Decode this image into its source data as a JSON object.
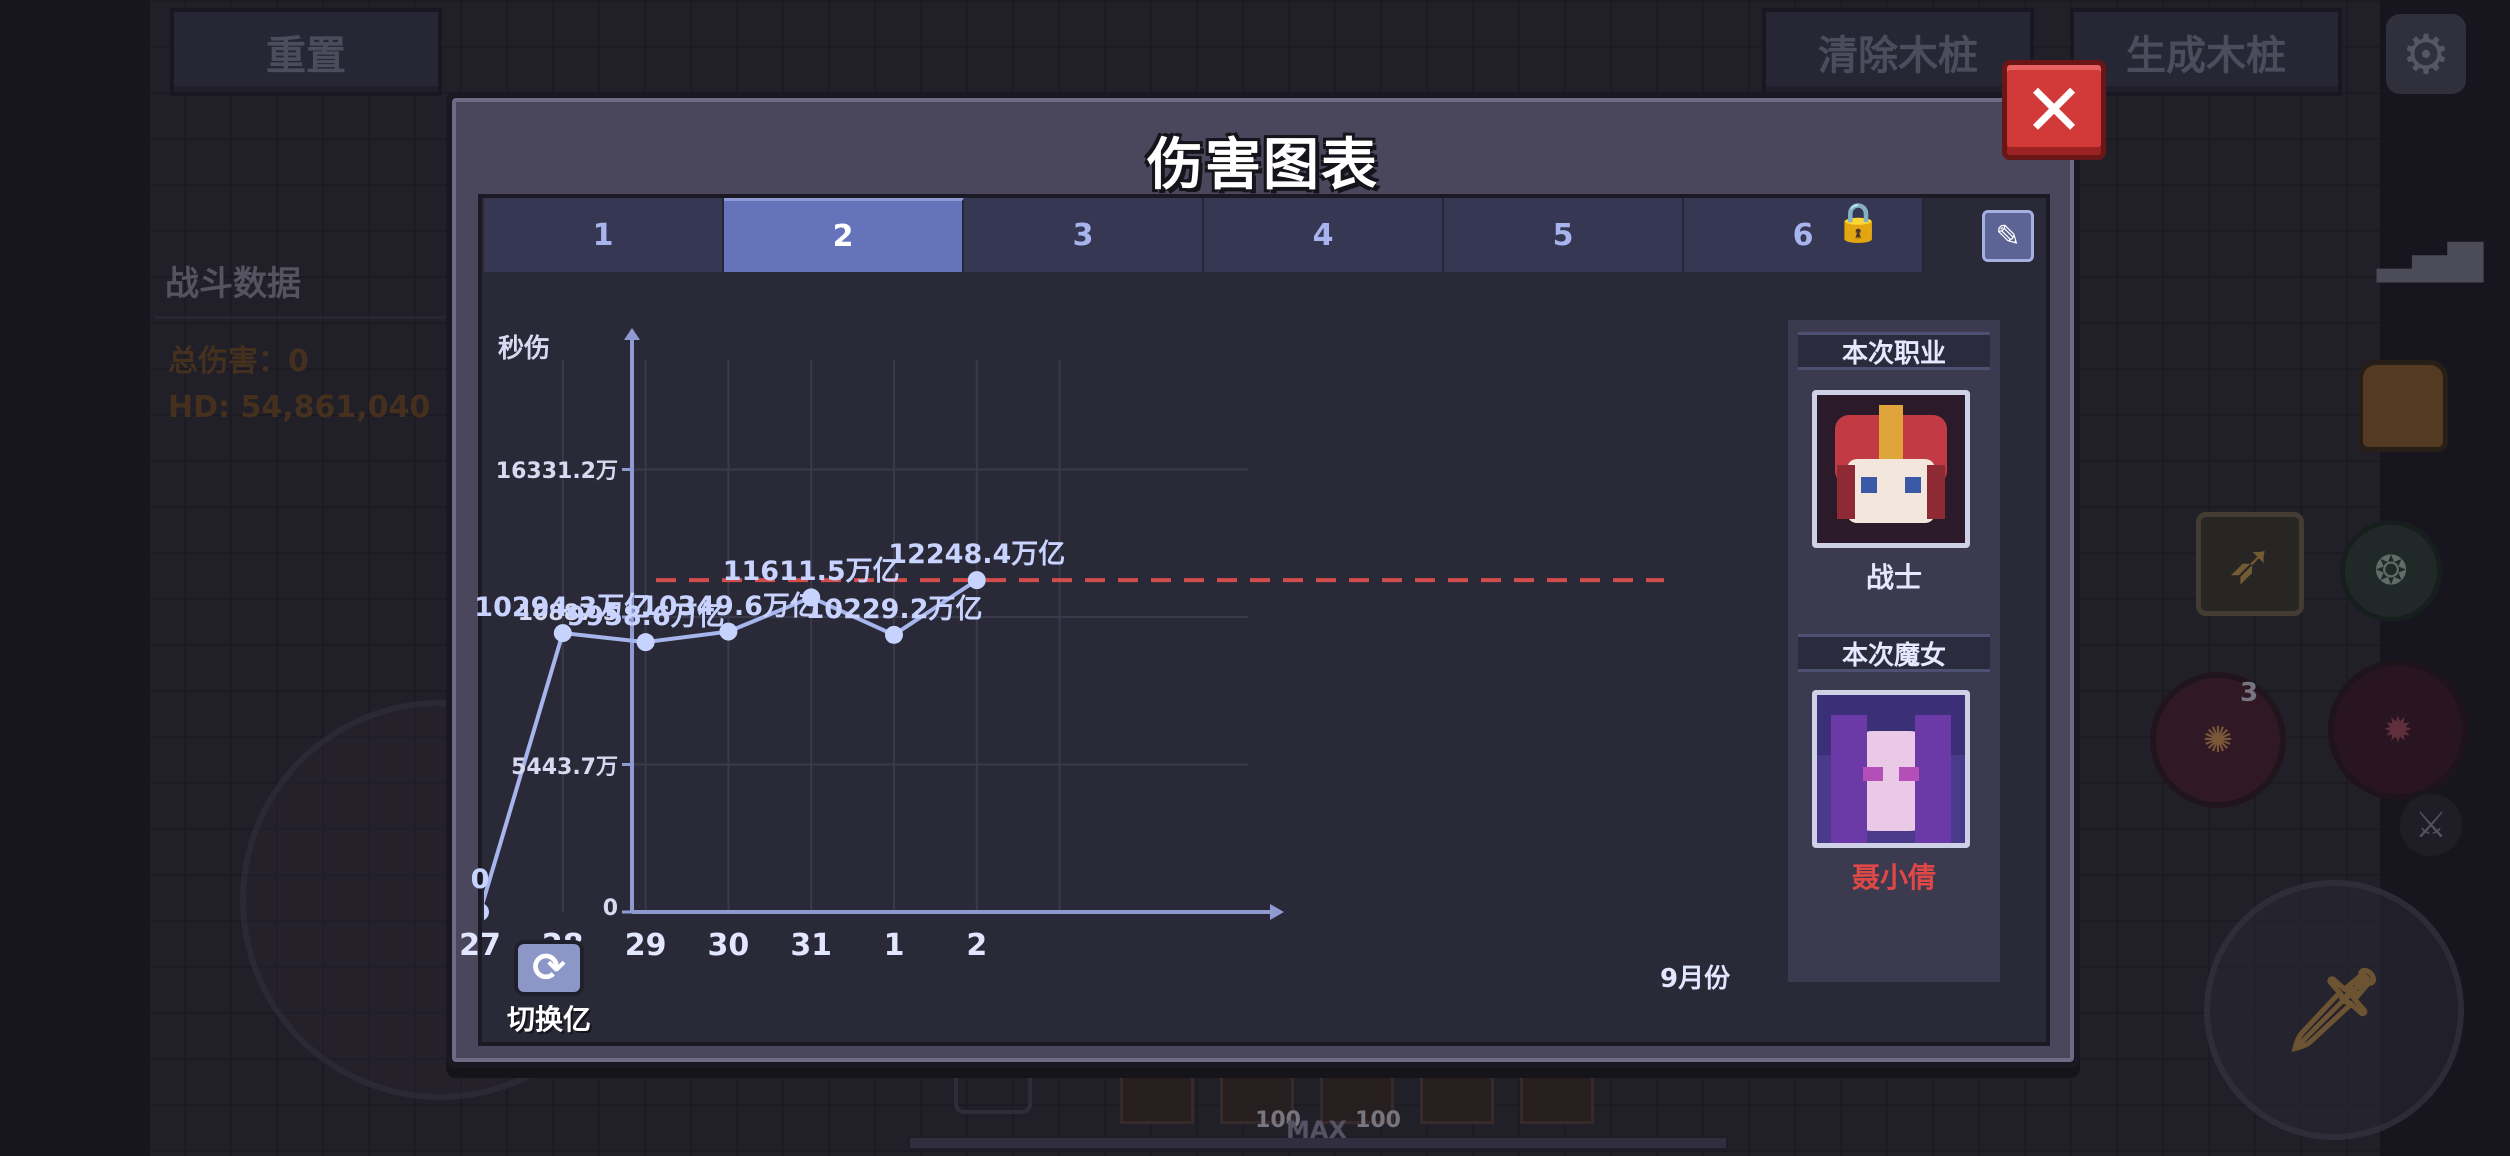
{
  "background": {
    "reset_label": "重置",
    "clear_label": "清除木桩",
    "spawn_label": "生成木桩",
    "battle_data_title": "战斗数据",
    "total_damage": "总伤害：0",
    "hd_text": "HD: 54,861,040",
    "orb_badge": "3",
    "bottom_counts": [
      "100",
      "100"
    ],
    "bottom_max": "MAX"
  },
  "modal": {
    "title": "伤害图表",
    "close_label": "✕",
    "tabs": [
      {
        "label": "1",
        "active": false
      },
      {
        "label": "2",
        "active": true
      },
      {
        "label": "3",
        "active": false
      },
      {
        "label": "4",
        "active": false
      },
      {
        "label": "5",
        "active": false
      },
      {
        "label": "6",
        "active": false
      }
    ],
    "lock_icon": "lock-icon",
    "edit_icon": "eraser-icon",
    "switch_label": "切换亿",
    "switch_icon": "swap-icon"
  },
  "info": {
    "class_header": "本次职业",
    "class_name": "战士",
    "witch_header": "本次魔女",
    "witch_name": "聂小倩",
    "witch_name_color": "#e04848"
  },
  "chart_data": {
    "type": "line",
    "y_title": "秒伤",
    "x_unit": "9月份",
    "categories": [
      "27",
      "28",
      "29",
      "30",
      "31",
      "1",
      "2"
    ],
    "series": [
      {
        "values": [
          0,
          10294.3,
          9958.6,
          10349.6,
          11611.5,
          10229.2,
          12248.4
        ],
        "labels": [
          "0",
          "10294.3万亿",
          "9958.6万亿",
          "10349.6万亿",
          "11611.5万亿",
          "10229.2万亿",
          "12248.4万亿"
        ]
      }
    ],
    "reference_line": 12248.4,
    "ylim": [
      0,
      21774.9
    ],
    "yticks": [
      {
        "value": 0,
        "label": "0"
      },
      {
        "value": 5443.7,
        "label": "5443.7万"
      },
      {
        "value": 10887.5,
        "label": "10887.5"
      },
      {
        "value": 16331.2,
        "label": "16331.2万"
      }
    ],
    "colors": {
      "line": "#a6b6ec",
      "point": "#c7d3ff",
      "reference": "#d24c4c",
      "grid": "#3a3a4a"
    },
    "grid": true
  }
}
